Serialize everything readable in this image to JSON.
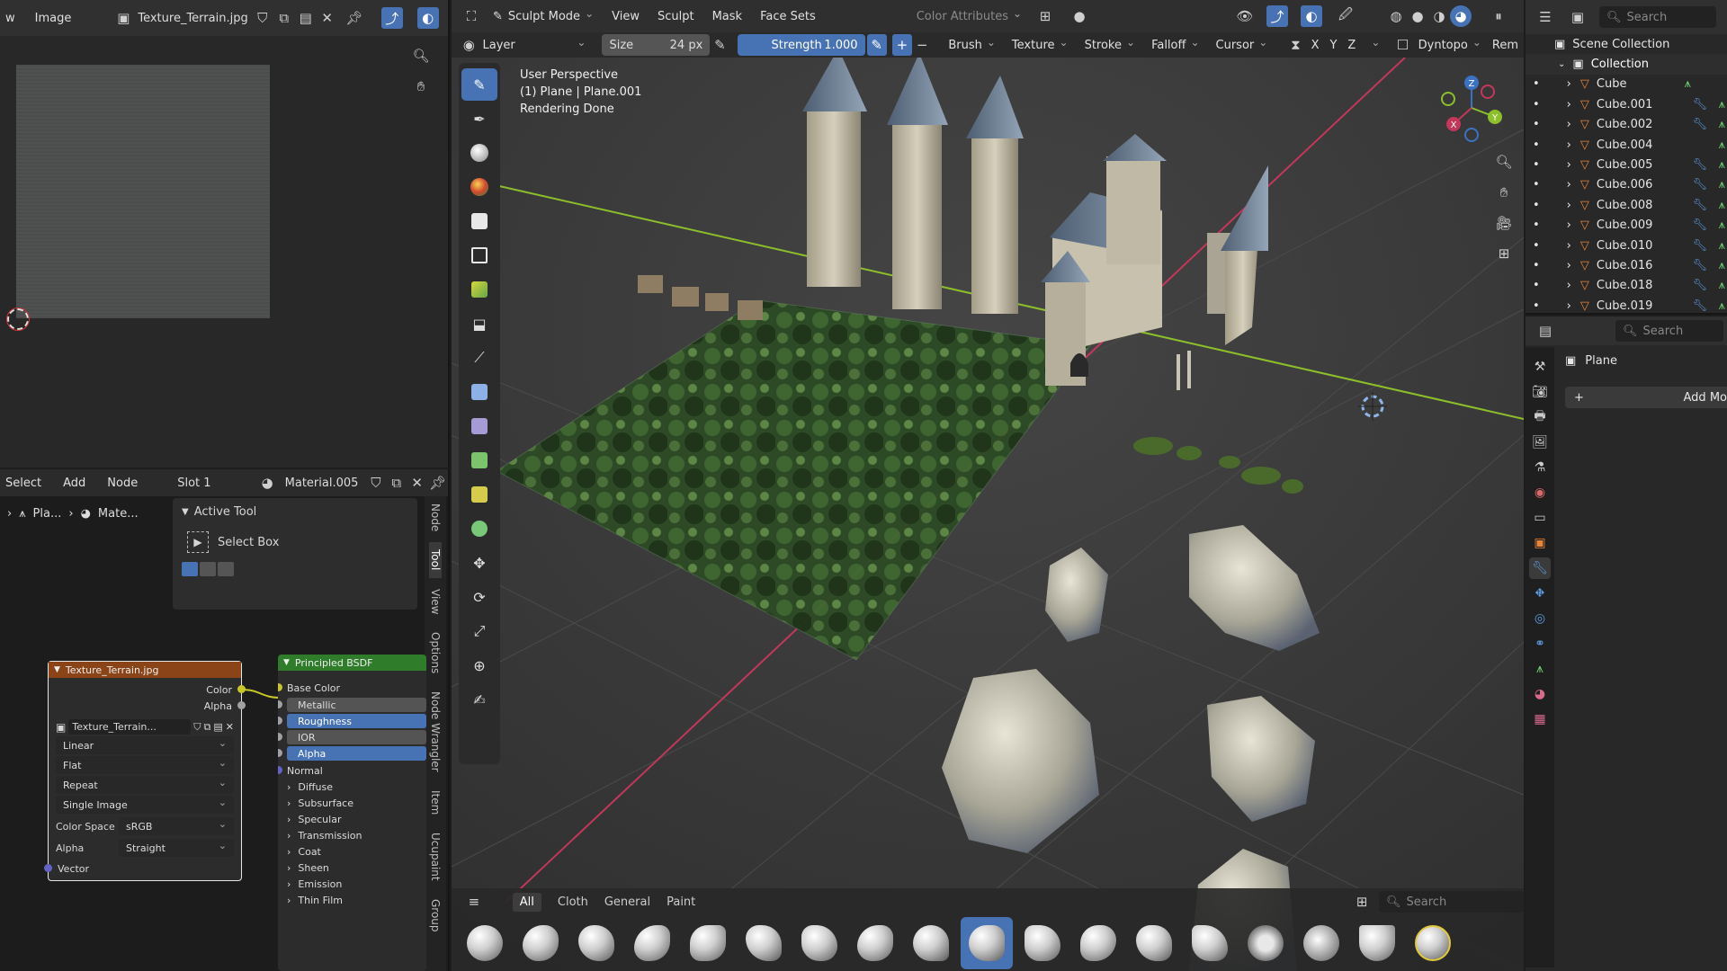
{
  "image_editor": {
    "header": {
      "menu_left": "w",
      "menu_image": "Image",
      "image_name": "Texture_Terrain.jpg"
    }
  },
  "node_editor": {
    "header": {
      "select": "Select",
      "add": "Add",
      "node": "Node",
      "slot": "Slot 1",
      "material": "Material.005"
    },
    "breadcrumb": {
      "object": "Pla...",
      "material": "Mate..."
    },
    "active_tool": {
      "title": "Active Tool",
      "tool_name": "Select Box"
    },
    "side_tabs": [
      "Node",
      "Tool",
      "View",
      "Options",
      "Node Wrangler",
      "Item",
      "Ucupaint",
      "Group"
    ],
    "image_node": {
      "title": "Texture_Terrain.jpg",
      "out_color": "Color",
      "out_alpha": "Alpha",
      "image_field": "Texture_Terrain...",
      "interpolation": "Linear",
      "projection": "Flat",
      "extension": "Repeat",
      "source": "Single Image",
      "color_space_label": "Color Space",
      "color_space": "sRGB",
      "alpha_label": "Alpha",
      "alpha_mode": "Straight",
      "in_vector": "Vector"
    },
    "bsdf_node": {
      "title": "Principled BSDF",
      "base_color": "Base Color",
      "metallic": "Metallic",
      "roughness": "Roughness",
      "ior": "IOR",
      "alpha": "Alpha",
      "normal": "Normal",
      "panels": [
        "Diffuse",
        "Subsurface",
        "Specular",
        "Transmission",
        "Coat",
        "Sheen",
        "Emission",
        "Thin Film"
      ]
    }
  },
  "viewport": {
    "header": {
      "mode": "Sculpt Mode",
      "menus": [
        "View",
        "Sculpt",
        "Mask",
        "Face Sets"
      ],
      "color_attributes": "Color Attributes"
    },
    "tool_settings": {
      "brush_name": "Layer",
      "size_label": "Size",
      "size_value": "24 px",
      "strength_label": "Strength",
      "strength_value": "1.000",
      "dropdowns": [
        "Brush",
        "Texture",
        "Stroke",
        "Falloff",
        "Cursor"
      ],
      "axes": [
        "X",
        "Y",
        "Z"
      ],
      "dyntopo": "Dyntopo",
      "remesh": "Rem"
    },
    "overlay": {
      "line1": "User Perspective",
      "line2": "(1) Plane | Plane.001",
      "line3": "Rendering Done"
    },
    "gizmo": {
      "x": "X",
      "y": "Y",
      "z": "Z"
    }
  },
  "asset_shelf": {
    "tabs": [
      "All",
      "Cloth",
      "General",
      "Paint"
    ],
    "active_tab": "All",
    "search_placeholder": "Search",
    "brush_count": 18,
    "active_brush_index": 9
  },
  "outliner": {
    "search_placeholder": "Search",
    "scene_collection": "Scene Collection",
    "collection": "Collection",
    "items": [
      "Cube",
      "Cube.001",
      "Cube.002",
      "Cube.004",
      "Cube.005",
      "Cube.006",
      "Cube.008",
      "Cube.009",
      "Cube.010",
      "Cube.016",
      "Cube.018",
      "Cube.019"
    ]
  },
  "properties": {
    "search_placeholder": "Search",
    "object_name": "Plane",
    "add_modifier": "Add Mo"
  },
  "colors": {
    "accent_blue": "#4772b3",
    "node_image_header": "#8a4418",
    "node_shader_header": "#2f7d2a",
    "socket_yellow": "#c7c729",
    "socket_grey": "#a1a1a1",
    "socket_blue": "#6363c7",
    "axis_x_red": "#c3375a",
    "axis_y_green": "#8cbf2a"
  }
}
